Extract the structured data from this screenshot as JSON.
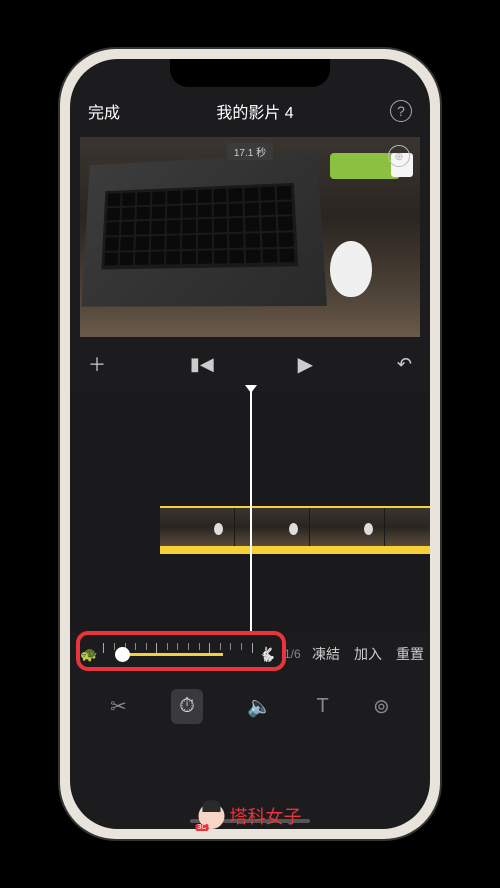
{
  "header": {
    "done_label": "完成",
    "title": "我的影片 4",
    "help_label": "?"
  },
  "preview": {
    "duration_badge": "17.1 秒",
    "zoom_icon_label": "⊕"
  },
  "playback": {
    "add": "＋",
    "prev": "▮◀",
    "play": "▶",
    "undo": "↶"
  },
  "speed": {
    "ratio": "1/6",
    "freeze_label": "凍結",
    "add_label": "加入",
    "reset_label": "重置"
  },
  "toolbar": {
    "cut": "✂",
    "speed": "⏱",
    "volume": "🔈",
    "text": "T",
    "filter": "⊚"
  },
  "watermark": {
    "badge": "3C",
    "text": "塔科女子"
  }
}
